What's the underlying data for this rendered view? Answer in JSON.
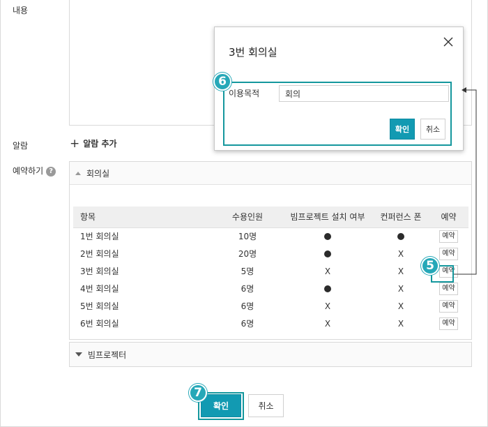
{
  "form": {
    "content_label": "내용",
    "alarm_label": "알람",
    "alarm_add": "알람 추가",
    "reserve_label": "예약하기",
    "help_icon": "?"
  },
  "rooms_panel": {
    "title": "회의실",
    "columns": [
      "항목",
      "수용인원",
      "빔프로젝트 설치 여부",
      "컨퍼런스 폰",
      "예약"
    ],
    "rows": [
      {
        "name": "1번 회의실",
        "capacity": "10명",
        "projector": "●",
        "conf_phone": "●",
        "reserve": "예약"
      },
      {
        "name": "2번 회의실",
        "capacity": "20명",
        "projector": "●",
        "conf_phone": "X",
        "reserve": "예약"
      },
      {
        "name": "3번 회의실",
        "capacity": "5명",
        "projector": "X",
        "conf_phone": "X",
        "reserve": "예약"
      },
      {
        "name": "4번 회의실",
        "capacity": "6명",
        "projector": "●",
        "conf_phone": "X",
        "reserve": "예약"
      },
      {
        "name": "5번 회의실",
        "capacity": "6명",
        "projector": "X",
        "conf_phone": "X",
        "reserve": "예약"
      },
      {
        "name": "6번 회의실",
        "capacity": "6명",
        "projector": "X",
        "conf_phone": "X",
        "reserve": "예약"
      }
    ]
  },
  "projector_panel": {
    "title": "빔프로젝터"
  },
  "footer": {
    "confirm": "확인",
    "cancel": "취소"
  },
  "modal": {
    "title": "3번 회의실",
    "field_label": "이용목적",
    "field_value": "회의",
    "confirm": "확인",
    "cancel": "취소"
  },
  "steps": {
    "s5": "5",
    "s6": "6",
    "s7": "7"
  },
  "colors": {
    "accent": "#129ab2",
    "highlight": "#14979d",
    "badge": "#26a8b8"
  }
}
